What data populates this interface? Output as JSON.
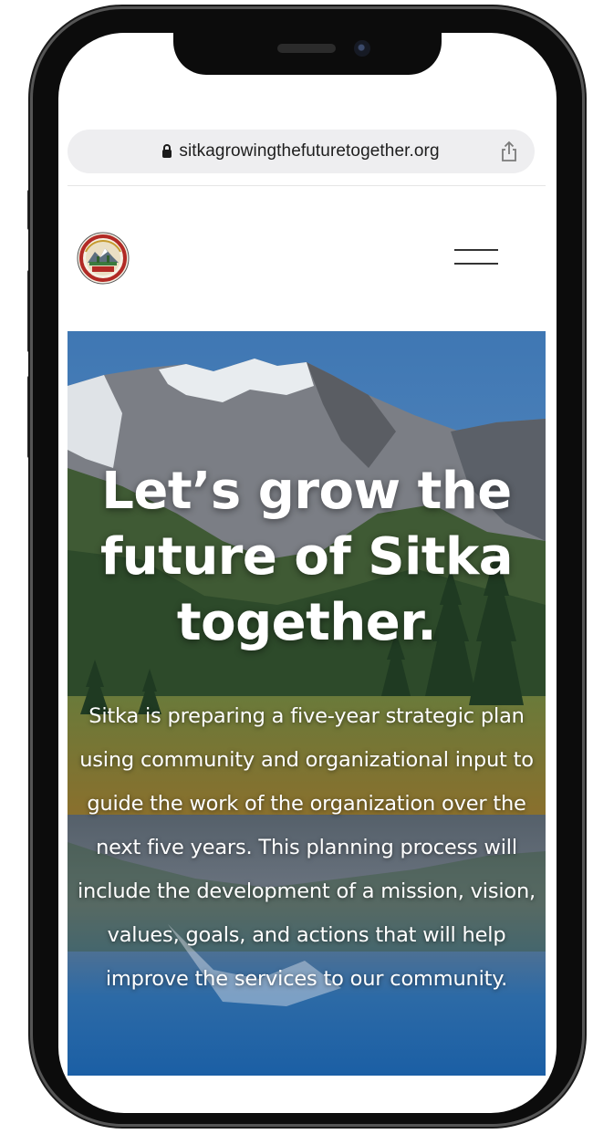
{
  "browser": {
    "url": "sitkagrowingthefuturetogether.org"
  },
  "header": {
    "logo_name": "sitka-growing-the-future-together-logo"
  },
  "hero": {
    "title_line_1": "Let’s grow the",
    "title_line_2": "future of Sitka",
    "title_line_3": "together.",
    "body": "Sitka is preparing a five-year strategic plan using community and organizational input to guide the work of the organization over the next five years. This planning process will include the development of a mission, vision, values, goals, and actions that will help improve the services to our community."
  },
  "colors": {
    "text_dark": "#1e1e1e",
    "url_bar_bg": "#eeeef0",
    "hero_text": "#ffffff",
    "lake_blue": "#1e63a8"
  }
}
